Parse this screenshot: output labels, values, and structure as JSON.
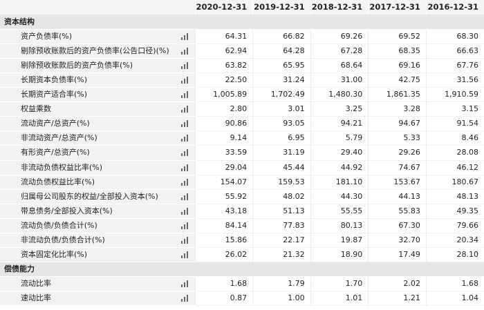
{
  "header": {
    "years": [
      "2020-12-31",
      "2019-12-31",
      "2018-12-31",
      "2017-12-31",
      "2016-12-31"
    ]
  },
  "sections": [
    {
      "title": "资本结构",
      "rows": [
        {
          "label": "资产负债率(%)",
          "values": [
            "64.31",
            "66.82",
            "69.26",
            "69.52",
            "68.30"
          ]
        },
        {
          "label": "剔除预收账款后的资产负债率(公告口径)(%)",
          "values": [
            "62.94",
            "64.28",
            "67.28",
            "68.35",
            "66.63"
          ]
        },
        {
          "label": "剔除预收账款后的资产负债率(%)",
          "values": [
            "63.82",
            "65.95",
            "68.64",
            "69.16",
            "67.76"
          ]
        },
        {
          "label": "长期资本负债率(%)",
          "values": [
            "22.50",
            "31.24",
            "31.00",
            "42.75",
            "31.56"
          ]
        },
        {
          "label": "长期资产适合率(%)",
          "values": [
            "1,005.89",
            "1,702.49",
            "1,480.30",
            "1,861.35",
            "1,910.59"
          ]
        },
        {
          "label": "权益乘数",
          "values": [
            "2.80",
            "3.01",
            "3.25",
            "3.28",
            "3.15"
          ]
        },
        {
          "label": "流动资产/总资产(%)",
          "values": [
            "90.86",
            "93.05",
            "94.21",
            "94.67",
            "91.54"
          ]
        },
        {
          "label": "非流动资产/总资产(%)",
          "values": [
            "9.14",
            "6.95",
            "5.79",
            "5.33",
            "8.46"
          ]
        },
        {
          "label": "有形资产/总资产(%)",
          "values": [
            "33.59",
            "31.19",
            "29.40",
            "29.26",
            "28.08"
          ]
        },
        {
          "label": "非流动负债权益比率(%)",
          "values": [
            "29.04",
            "45.44",
            "44.92",
            "74.67",
            "46.12"
          ]
        },
        {
          "label": "流动负债权益比率(%)",
          "values": [
            "154.07",
            "159.53",
            "181.10",
            "153.67",
            "180.67"
          ]
        },
        {
          "label": "归属母公司股东的权益/全部投入资本(%)",
          "values": [
            "55.92",
            "48.02",
            "44.30",
            "44.13",
            "48.13"
          ]
        },
        {
          "label": "带息债务/全部投入资本(%)",
          "values": [
            "43.18",
            "51.13",
            "55.55",
            "55.83",
            "49.35"
          ]
        },
        {
          "label": "流动负债/负债合计(%)",
          "values": [
            "84.14",
            "77.83",
            "80.13",
            "67.30",
            "79.66"
          ]
        },
        {
          "label": "非流动负债/负债合计(%)",
          "values": [
            "15.86",
            "22.17",
            "19.87",
            "32.70",
            "20.34"
          ]
        },
        {
          "label": "资本固定化比率(%)",
          "values": [
            "26.02",
            "21.32",
            "18.90",
            "17.49",
            "28.10"
          ]
        }
      ]
    },
    {
      "title": "偿债能力",
      "rows": [
        {
          "label": "流动比率",
          "values": [
            "1.68",
            "1.79",
            "1.70",
            "2.02",
            "1.68"
          ]
        },
        {
          "label": "速动比率",
          "values": [
            "0.87",
            "1.00",
            "1.01",
            "1.21",
            "1.04"
          ]
        }
      ]
    }
  ],
  "icons": {
    "row_chart": "bar-chart-icon"
  }
}
